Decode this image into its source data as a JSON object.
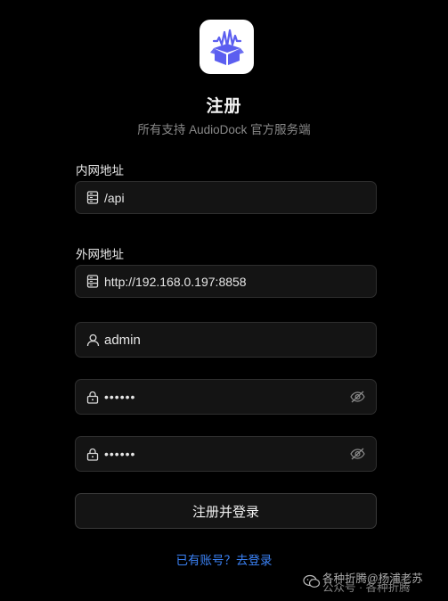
{
  "header": {
    "title": "注册",
    "subtitle": "所有支持 AudioDock 官方服务端",
    "logo_icon": "audio-box-logo-icon"
  },
  "form": {
    "internal": {
      "label": "内网地址",
      "value": "/api",
      "icon": "server-icon"
    },
    "external": {
      "label": "外网地址",
      "value": "http://192.168.0.197:8858",
      "icon": "server-icon"
    },
    "username": {
      "value": "admin",
      "icon": "user-icon"
    },
    "password": {
      "value": "••••••",
      "icon": "lock-icon",
      "toggle_icon": "eye-off-icon"
    },
    "confirm_password": {
      "value": "••••••",
      "icon": "lock-icon",
      "toggle_icon": "eye-off-icon"
    },
    "submit_label": "注册并登录",
    "login_link": "已有账号？去登录"
  },
  "watermark": {
    "line1": "各种折腾@杨浦老苏",
    "line2": "公众号 · 各种折腾"
  },
  "colors": {
    "background": "#000000",
    "field_bg": "#141414",
    "field_border": "#2e2e2e",
    "link": "#3b82f6",
    "logo_accent": "#5b5ef0"
  }
}
